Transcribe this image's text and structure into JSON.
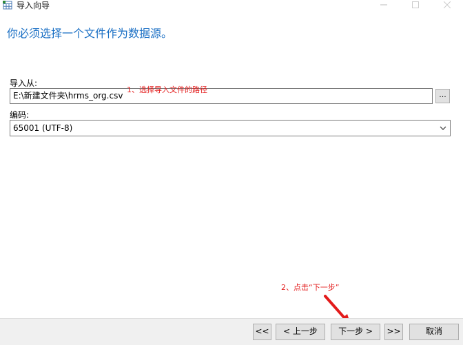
{
  "window": {
    "title": "导入向导"
  },
  "heading": "你必须选择一个文件作为数据源。",
  "import_from": {
    "label": "导入从:",
    "value": "E:\\新建文件夹\\hrms_org.csv",
    "browse_label": "..."
  },
  "encoding": {
    "label": "编码:",
    "selected": "65001 (UTF-8)"
  },
  "annotations": {
    "step1": "1、选择导入文件的路径",
    "step2": "2、点击“下一步”"
  },
  "buttons": {
    "first": "<<",
    "prev": "< 上一步",
    "next": "下一步 >",
    "last": ">>",
    "cancel": "取消"
  },
  "colors": {
    "heading": "#1a6fc4",
    "annotation": "#e31b1b"
  }
}
